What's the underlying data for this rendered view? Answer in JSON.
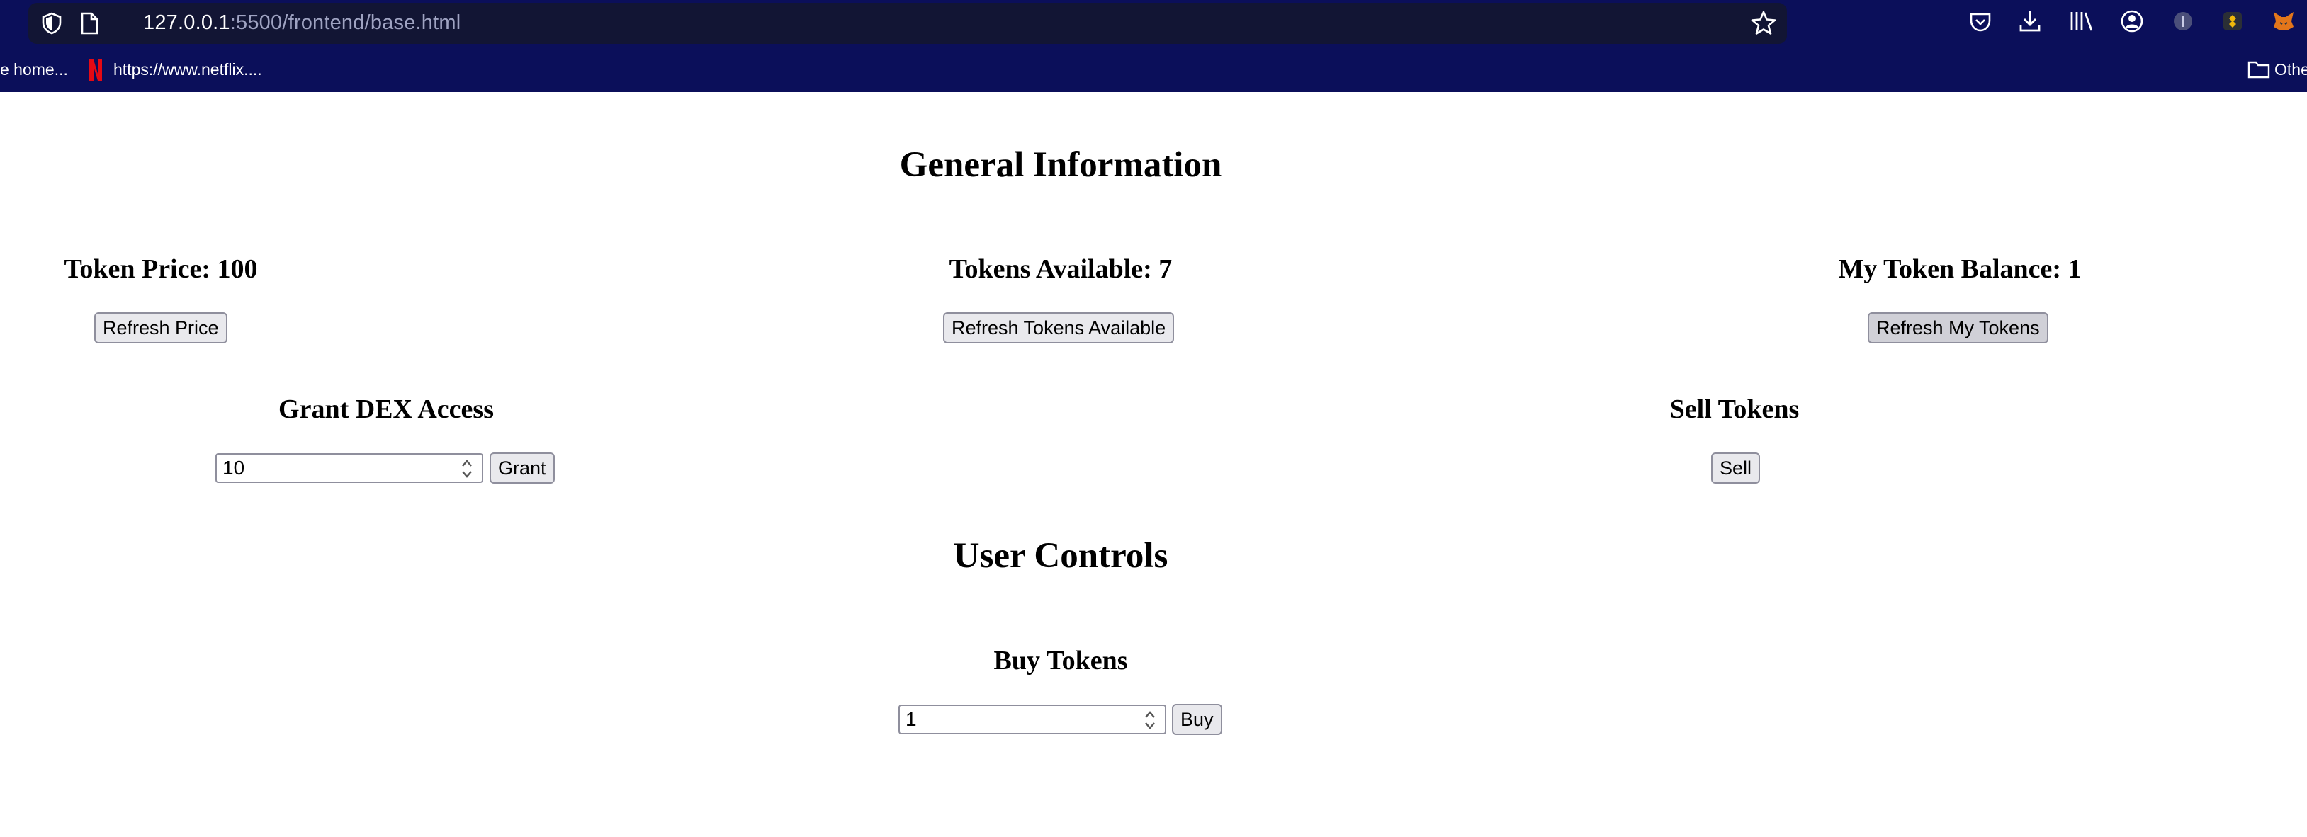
{
  "browser": {
    "url_host": "127.0.0.1",
    "url_path": ":5500/frontend/base.html",
    "bookmarks": [
      {
        "label": "e home..."
      },
      {
        "label": "https://www.netflix...."
      },
      {
        "label": "Othe"
      }
    ]
  },
  "general": {
    "title": "General Information",
    "token_price": "Token Price: 100",
    "refresh_price": "Refresh Price",
    "tokens_available": "Tokens Available: 7",
    "refresh_tokens_available": "Refresh Tokens Available",
    "my_balance": "My Token Balance: 1",
    "refresh_my_tokens": "Refresh My Tokens",
    "grant_title": "Grant DEX Access",
    "grant_value": "10",
    "grant_button": "Grant",
    "sell_title": "Sell Tokens",
    "sell_button": "Sell"
  },
  "user_controls": {
    "title": "User Controls",
    "buy_title": "Buy Tokens",
    "buy_value": "1",
    "buy_button": "Buy"
  },
  "colors": {
    "chrome_bg": "#0b0f5a",
    "urlbar_bg": "#121534",
    "button_bg": "#e9e9ed"
  }
}
